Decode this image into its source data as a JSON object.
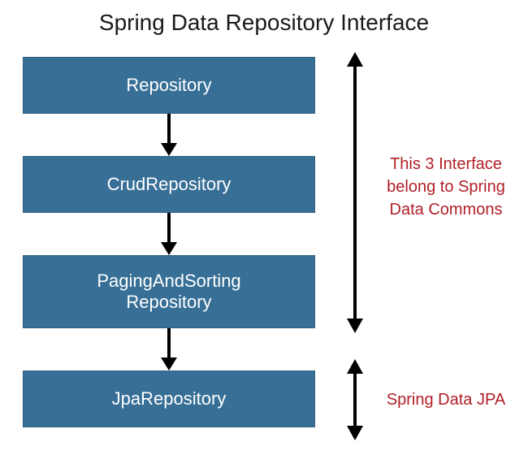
{
  "title": "Spring Data Repository Interface",
  "boxes": {
    "repository": "Repository",
    "crud": "CrudRepository",
    "paging_line1": "PagingAndSorting",
    "paging_line2": "Repository",
    "jpa": "JpaRepository"
  },
  "annotations": {
    "commons_line1": "This 3 Interface",
    "commons_line2": "belong to Spring",
    "commons_line3": "Data Commons",
    "jpa": "Spring Data JPA"
  },
  "colors": {
    "box_bg": "#386f96",
    "annotation": "#b11f27"
  }
}
